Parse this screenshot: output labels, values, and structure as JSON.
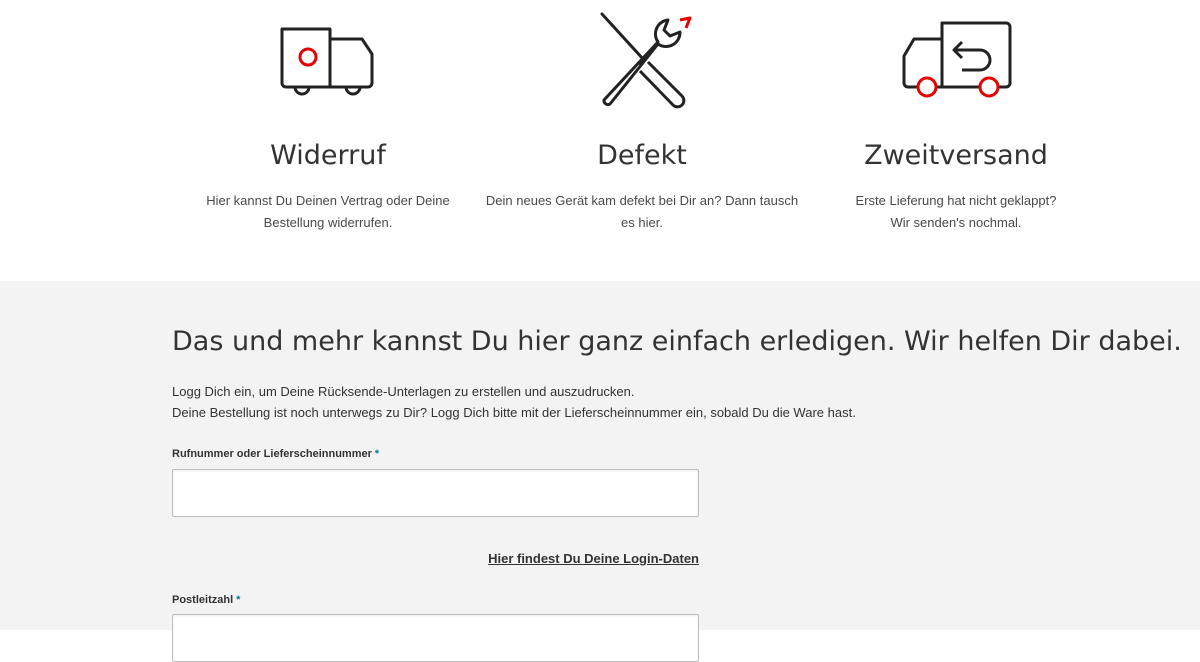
{
  "features": [
    {
      "icon": "truck-icon",
      "title": "Widerruf",
      "text_line1": "Hier kannst Du Deinen Vertrag oder Deine",
      "text_line2": "Bestellung widerrufen."
    },
    {
      "icon": "wrench-screwdriver-icon",
      "title": "Defekt",
      "text_line1": "Dein neues Gerät kam defekt bei Dir an? Dann tausch",
      "text_line2": "es hier."
    },
    {
      "icon": "return-truck-icon",
      "title": "Zweitversand",
      "text_line1": "Erste Lieferung hat nicht geklappt?",
      "text_line2": "Wir senden's nochmal."
    }
  ],
  "main": {
    "headline": "Das und mehr kannst Du hier ganz einfach erledigen. Wir helfen Dir dabei.",
    "intro_line1": "Logg Dich ein, um Deine Rücksende-Unterlagen zu erstellen und auszudrucken.",
    "intro_line2": "Deine Bestellung ist noch unterwegs zu Dir? Logg Dich bitte mit der Lieferscheinnummer ein, sobald Du die Ware hast.",
    "field1": {
      "label": "Rufnummer oder Lieferscheinnummer",
      "required": "*",
      "value": ""
    },
    "login_link": "Hier findest Du Deine Login-Daten",
    "field2": {
      "label": "Postleitzahl",
      "required": "*",
      "value": ""
    }
  },
  "colors": {
    "accent": "#e60000",
    "required": "#007c92",
    "section_bg": "#f3f3f3"
  }
}
